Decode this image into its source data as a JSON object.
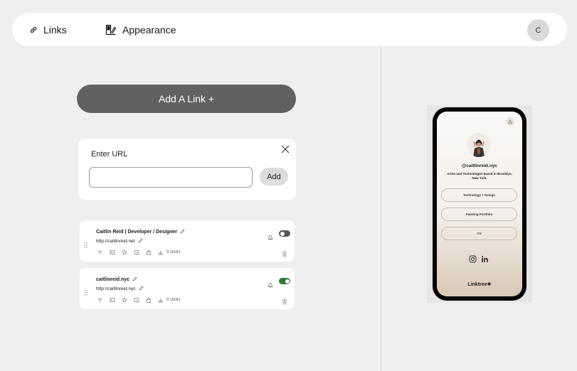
{
  "nav": {
    "links_label": "Links",
    "appearance_label": "Appearance",
    "avatar_initial": "C"
  },
  "editor": {
    "add_link_label": "Add A Link +",
    "url_form": {
      "label": "Enter URL",
      "input_value": "",
      "add_label": "Add"
    },
    "links": [
      {
        "title": "Caitlin Reid | Developer / Designer",
        "url": "http://caitlinreid.net",
        "clicks": "0 clicks",
        "enabled": false
      },
      {
        "title": "caitlinreid.nyc",
        "url": "http://caitlinreid.nyc",
        "clicks": "0 clicks",
        "enabled": true
      }
    ]
  },
  "preview": {
    "handle": "@caitlinreid.nyc",
    "bio": "Artist and Technologist based in Brooklyn, New York.",
    "buttons": [
      "Technology + Design",
      "Painting Portfolio",
      "CV"
    ],
    "socials": [
      "instagram-icon",
      "linkedin-icon"
    ],
    "brand": "Linktree✱"
  },
  "colors": {
    "toggle_on": "#2f7d32",
    "toggle_off": "#555555",
    "add_button": "#616161"
  }
}
